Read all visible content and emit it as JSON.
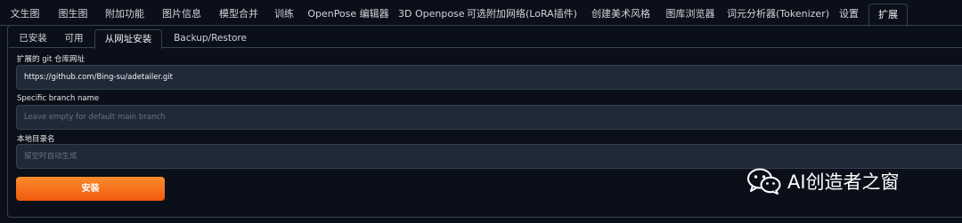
{
  "top_tabs": [
    "文生图",
    "图生图",
    "附加功能",
    "图片信息",
    "模型合并",
    "训练",
    "OpenPose 编辑器",
    "3D Openpose",
    "可选附加网络(LoRA插件)",
    "创建美术风格",
    "图库浏览器",
    "词元分析器(Tokenizer)",
    "设置",
    "扩展"
  ],
  "sub_tabs": [
    "已安装",
    "可用",
    "从网址安装",
    "Backup/Restore"
  ],
  "form": {
    "url_label": "扩展的 git 仓库网址",
    "url_value": "https://github.com/Bing-su/adetailer.git",
    "branch_label": "Specific branch name",
    "branch_placeholder": "Leave empty for default main branch",
    "dir_label": "本地目录名",
    "dir_placeholder": "留空时自动生成",
    "install_label": "安装"
  },
  "watermark": {
    "text": "AI创造者之窗",
    "icon": "wechat-icon"
  }
}
